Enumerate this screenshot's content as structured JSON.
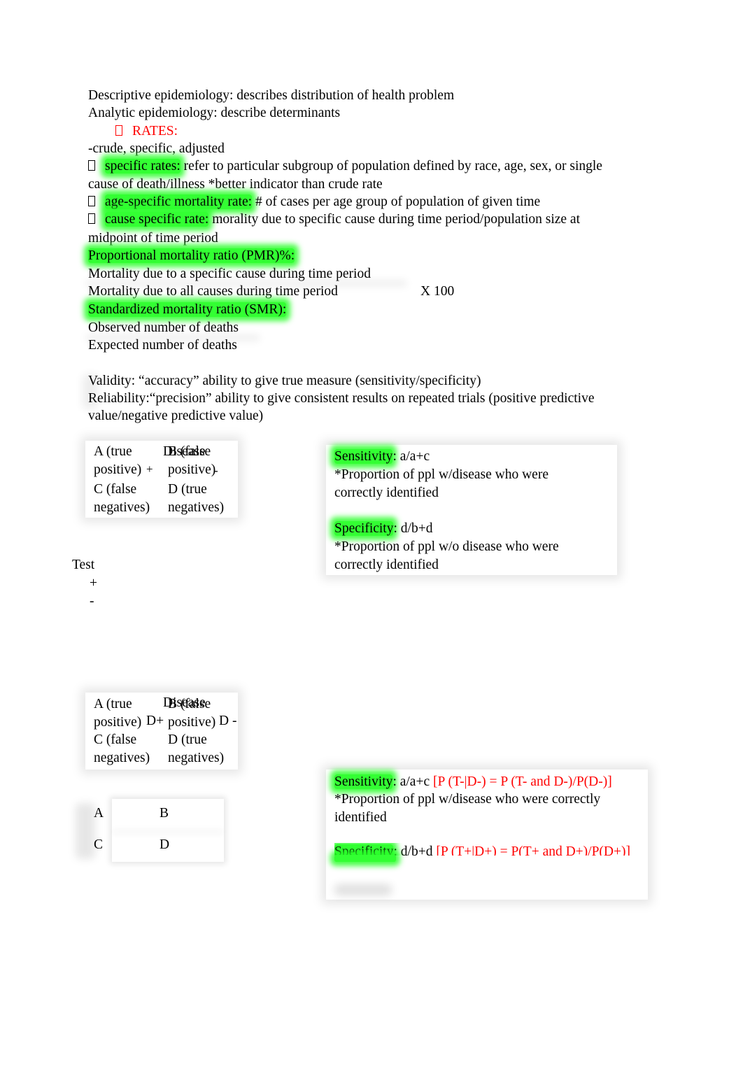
{
  "document": {
    "intro": {
      "descriptive": "Descriptive epidemiology: describes distribution of health problem",
      "analytic": "Analytic epidemiology: describe determinants"
    },
    "rates": {
      "heading": "RATES:",
      "heading_color": "#ff0000",
      "types": "-crude, specific, adjusted",
      "items": [
        {
          "term": "specific rates:",
          "definition": " refer to particular subgroup of population defined by race, age, sex, or single",
          "continuation": "cause of death/illness *better indicator than crude rate"
        },
        {
          "term": "age-specific mortality rate:",
          "definition": " # of cases per age group of population of given time"
        },
        {
          "term": "cause specific rate:",
          "definition": " morality due to specific cause during time period/population size at",
          "continuation": "midpoint of time period"
        }
      ]
    },
    "pmr": {
      "heading": "Proportional mortality ratio (PMR)%:",
      "numerator": "Mortality due to a specific cause during time period",
      "denominator": "Mortality due to all causes during time period",
      "multiplier": "X 100"
    },
    "smr": {
      "heading": "Standardized mortality ratio (SMR):",
      "numerator": "Observed number of deaths",
      "denominator": "Expected number of deaths"
    },
    "validity": {
      "line1": "Validity: “accuracy” ability to give true measure (sensitivity/specificity)",
      "line2": "Reliability:“precision” ability to give consistent results on repeated trials (positive predictive",
      "line3": "value/negative predictive value)"
    },
    "table1": {
      "disease_label": "Disease",
      "col_plus": "+",
      "col_minus": "-",
      "cells": {
        "a": "A (true positive)",
        "b": "B (false positive)",
        "c": "C (false negatives)",
        "d": "D (true negatives)"
      }
    },
    "box1": {
      "sensitivity_term": "Sensitivity",
      "sensitivity_formula": ": a/a+c",
      "sensitivity_note": "*Proportion of ppl w/disease who were correctly identified",
      "specificity_term": "Specificity",
      "specificity_formula": ": d/b+d",
      "specificity_note": "*Proportion of ppl w/o disease who were correctly identified"
    },
    "test_labels": {
      "title": "Test",
      "plus": "+",
      "minus": "-"
    },
    "table2": {
      "disease_label": "Disease",
      "col_plus": "D+",
      "col_minus": "D -",
      "cells": {
        "a": "A (true positive)",
        "b": "B (false positive)",
        "c": "C (false negatives)",
        "d": "D (true negatives)"
      }
    },
    "table3": {
      "cells": [
        "A",
        "B",
        "C",
        "D"
      ]
    },
    "box2": {
      "sensitivity_term": "Sensitivity",
      "sensitivity_formula": ": a/a+c ",
      "sensitivity_prob": "[P (T-|D-) = P (T- and D-)/P(D-)]",
      "sensitivity_note": "*Proportion of ppl w/disease who were correctly identified",
      "specificity_term": "Specificity",
      "specificity_formula": ": d/b+d ",
      "specificity_prob": "[P (T+|D+) = P(T+ and D+)/P(D+)]",
      "prob_color": "#ff0000"
    },
    "highlight_color": "#33ff33"
  }
}
